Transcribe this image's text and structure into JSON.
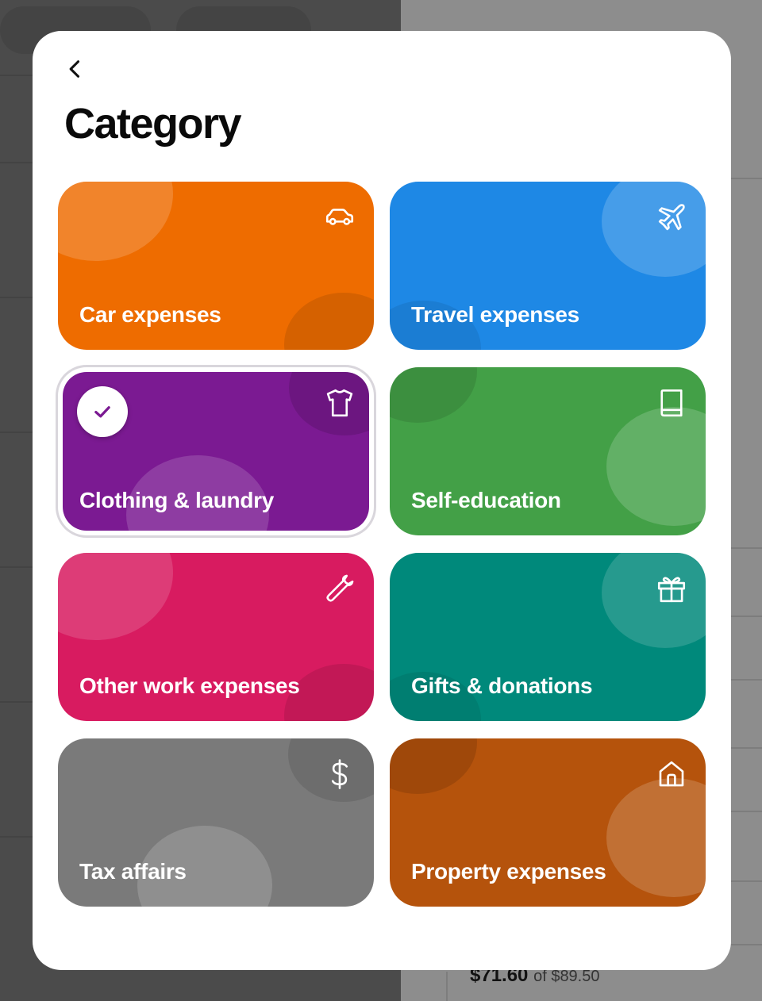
{
  "modal": {
    "title": "Category",
    "back_icon": "chevron-left-icon"
  },
  "categories": [
    {
      "label": "Car expenses",
      "icon": "car-icon",
      "color": "#EE6C00",
      "selected": false
    },
    {
      "label": "Travel expenses",
      "icon": "airplane-icon",
      "color": "#1E88E5",
      "selected": false
    },
    {
      "label": "Clothing & laundry",
      "icon": "tshirt-icon",
      "color": "#7B1A92",
      "selected": true
    },
    {
      "label": "Self-education",
      "icon": "book-icon",
      "color": "#43A047",
      "selected": false
    },
    {
      "label": "Other work expenses",
      "icon": "wrench-icon",
      "color": "#D81B60",
      "selected": false
    },
    {
      "label": "Gifts & donations",
      "icon": "gift-icon",
      "color": "#00897B",
      "selected": false
    },
    {
      "label": "Tax affairs",
      "icon": "dollar-icon",
      "color": "#7A7A7A",
      "selected": false
    },
    {
      "label": "Property expenses",
      "icon": "house-icon",
      "color": "#B5530C",
      "selected": false
    }
  ],
  "background": {
    "price": "$71.60",
    "price_of": "of $89.50"
  }
}
